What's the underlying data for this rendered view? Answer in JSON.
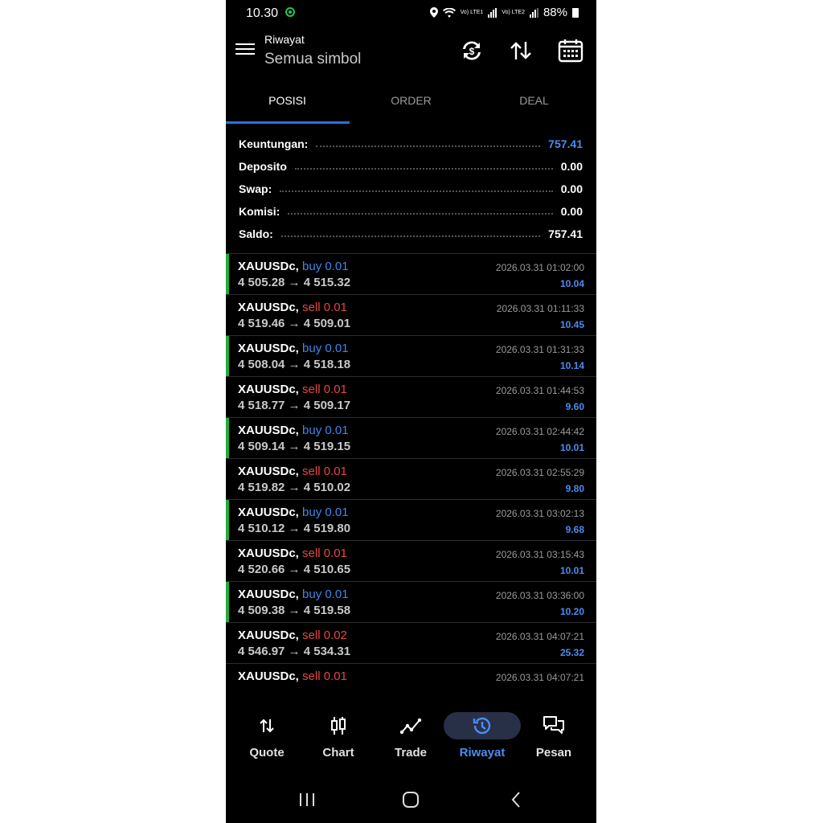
{
  "status_bar": {
    "time": "10.30",
    "network1": "Vo) LTE1",
    "network2": "Vo) LTE2",
    "battery": "88%"
  },
  "header": {
    "title": "Riwayat",
    "subtitle": "Semua simbol"
  },
  "tabs": [
    {
      "label": "POSISI",
      "active": true
    },
    {
      "label": "ORDER",
      "active": false
    },
    {
      "label": "DEAL",
      "active": false
    }
  ],
  "summary": [
    {
      "label": "Keuntungan:",
      "value": "757.41"
    },
    {
      "label": "Deposito",
      "value": "0.00"
    },
    {
      "label": "Swap:",
      "value": "0.00"
    },
    {
      "label": "Komisi:",
      "value": "0.00"
    },
    {
      "label": "Saldo:",
      "value": "757.41"
    }
  ],
  "deals": [
    {
      "symbol": "XAUUSDc,",
      "type": "buy 0.01",
      "prices": "4 505.28 → 4 515.32",
      "time": "2026.03.31 01:02:00",
      "profit": "10.04"
    },
    {
      "symbol": "XAUUSDc,",
      "type": "sell 0.01",
      "prices": "4 519.46 → 4 509.01",
      "time": "2026.03.31 01:11:33",
      "profit": "10.45"
    },
    {
      "symbol": "XAUUSDc,",
      "type": "buy 0.01",
      "prices": "4 508.04 → 4 518.18",
      "time": "2026.03.31 01:31:33",
      "profit": "10.14"
    },
    {
      "symbol": "XAUUSDc,",
      "type": "sell 0.01",
      "prices": "4 518.77 → 4 509.17",
      "time": "2026.03.31 01:44:53",
      "profit": "9.60"
    },
    {
      "symbol": "XAUUSDc,",
      "type": "buy 0.01",
      "prices": "4 509.14 → 4 519.15",
      "time": "2026.03.31 02:44:42",
      "profit": "10.01"
    },
    {
      "symbol": "XAUUSDc,",
      "type": "sell 0.01",
      "prices": "4 519.82 → 4 510.02",
      "time": "2026.03.31 02:55:29",
      "profit": "9.80"
    },
    {
      "symbol": "XAUUSDc,",
      "type": "buy 0.01",
      "prices": "4 510.12 → 4 519.80",
      "time": "2026.03.31 03:02:13",
      "profit": "9.68"
    },
    {
      "symbol": "XAUUSDc,",
      "type": "sell 0.01",
      "prices": "4 520.66 → 4 510.65",
      "time": "2026.03.31 03:15:43",
      "profit": "10.01"
    },
    {
      "symbol": "XAUUSDc,",
      "type": "buy 0.01",
      "prices": "4 509.38 → 4 519.58",
      "time": "2026.03.31 03:36:00",
      "profit": "10.20"
    },
    {
      "symbol": "XAUUSDc,",
      "type": "sell 0.02",
      "prices": "4 546.97 → 4 534.31",
      "time": "2026.03.31 04:07:21",
      "profit": "25.32"
    },
    {
      "symbol": "XAUUSDc,",
      "type": "sell 0.01",
      "prices": "",
      "time": "2026.03.31 04:07:21",
      "profit": ""
    }
  ],
  "bottom_nav": [
    {
      "label": "Quote",
      "icon": "quote-arrows-icon",
      "active": false
    },
    {
      "label": "Chart",
      "icon": "candlestick-icon",
      "active": false
    },
    {
      "label": "Trade",
      "icon": "trade-line-icon",
      "active": false
    },
    {
      "label": "Riwayat",
      "icon": "history-icon",
      "active": true
    },
    {
      "label": "Pesan",
      "icon": "messages-icon",
      "active": false
    }
  ],
  "colors": {
    "accent": "#4c8cf0",
    "buy": "#3f86ec",
    "sell": "#e84545",
    "buy_marker": "#25a83f",
    "background": "#000000"
  }
}
